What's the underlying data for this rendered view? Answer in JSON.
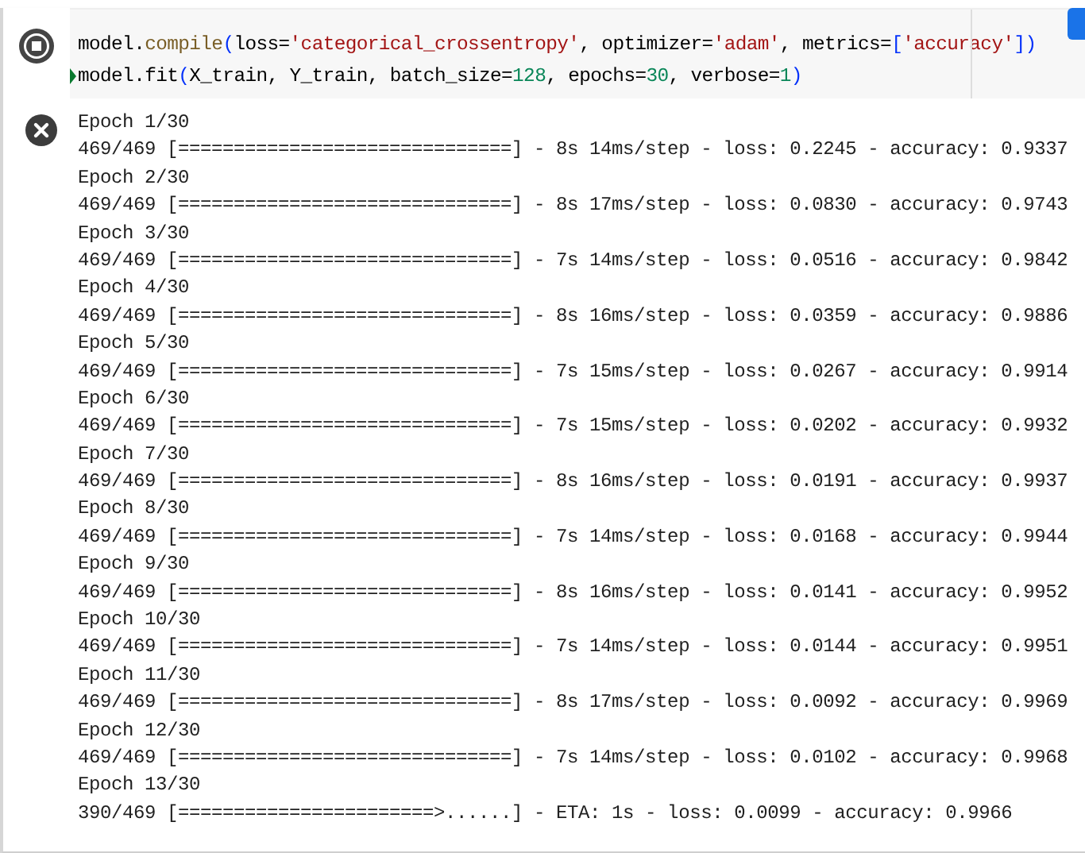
{
  "code_cell": {
    "running": true,
    "lines": [
      {
        "cursor": false,
        "tokens": [
          {
            "kind": "plain",
            "text": "model."
          },
          {
            "kind": "func",
            "text": "compile"
          },
          {
            "kind": "paren",
            "text": "("
          },
          {
            "kind": "plain",
            "text": "loss="
          },
          {
            "kind": "string",
            "text": "'categorical_crossentropy'"
          },
          {
            "kind": "plain",
            "text": ", optimizer="
          },
          {
            "kind": "string",
            "text": "'adam'"
          },
          {
            "kind": "plain",
            "text": ", metrics="
          },
          {
            "kind": "paren",
            "text": "["
          },
          {
            "kind": "string",
            "text": "'accuracy'"
          },
          {
            "kind": "paren",
            "text": "])"
          }
        ]
      },
      {
        "cursor": true,
        "tokens": [
          {
            "kind": "plain",
            "text": "model.fit"
          },
          {
            "kind": "paren",
            "text": "("
          },
          {
            "kind": "plain",
            "text": "X_train, Y_train, batch_size="
          },
          {
            "kind": "number",
            "text": "128"
          },
          {
            "kind": "plain",
            "text": ", epochs="
          },
          {
            "kind": "number",
            "text": "30"
          },
          {
            "kind": "plain",
            "text": ", verbose="
          },
          {
            "kind": "number",
            "text": "1"
          },
          {
            "kind": "paren",
            "text": ")"
          }
        ]
      }
    ]
  },
  "output": {
    "lines": [
      "Epoch 1/30",
      "469/469 [==============================] - 8s 14ms/step - loss: 0.2245 - accuracy: 0.9337",
      "Epoch 2/30",
      "469/469 [==============================] - 8s 17ms/step - loss: 0.0830 - accuracy: 0.9743",
      "Epoch 3/30",
      "469/469 [==============================] - 7s 14ms/step - loss: 0.0516 - accuracy: 0.9842",
      "Epoch 4/30",
      "469/469 [==============================] - 8s 16ms/step - loss: 0.0359 - accuracy: 0.9886",
      "Epoch 5/30",
      "469/469 [==============================] - 7s 15ms/step - loss: 0.0267 - accuracy: 0.9914",
      "Epoch 6/30",
      "469/469 [==============================] - 7s 15ms/step - loss: 0.0202 - accuracy: 0.9932",
      "Epoch 7/30",
      "469/469 [==============================] - 8s 16ms/step - loss: 0.0191 - accuracy: 0.9937",
      "Epoch 8/30",
      "469/469 [==============================] - 7s 14ms/step - loss: 0.0168 - accuracy: 0.9944",
      "Epoch 9/30",
      "469/469 [==============================] - 8s 16ms/step - loss: 0.0141 - accuracy: 0.9952",
      "Epoch 10/30",
      "469/469 [==============================] - 7s 14ms/step - loss: 0.0144 - accuracy: 0.9951",
      "Epoch 11/30",
      "469/469 [==============================] - 8s 17ms/step - loss: 0.0092 - accuracy: 0.9969",
      "Epoch 12/30",
      "469/469 [==============================] - 7s 14ms/step - loss: 0.0102 - accuracy: 0.9968",
      "Epoch 13/30",
      "390/469 [=======================>......] - ETA: 1s - loss: 0.0099 - accuracy: 0.9966"
    ]
  }
}
